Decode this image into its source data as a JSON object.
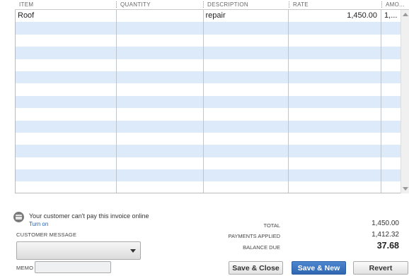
{
  "grid": {
    "columns": [
      "ITEM",
      "QUANTITY",
      "DESCRIPTION",
      "RATE",
      "AMO..."
    ],
    "rows": [
      {
        "item": "Roof",
        "quantity": "",
        "description": "repair",
        "rate": "1,450.00",
        "amount": "1,..."
      }
    ],
    "empty_row_count": 14
  },
  "payment": {
    "notice": "Your customer can't pay this invoice online",
    "turn_on": "Turn on"
  },
  "form": {
    "customer_message_label": "CUSTOMER MESSAGE",
    "customer_message_value": "",
    "memo_label": "MEMO",
    "memo_value": ""
  },
  "totals": {
    "total_label": "TOTAL",
    "total_value": "1,450.00",
    "payments_label": "PAYMENTS APPLIED",
    "payments_value": "1,412.32",
    "balance_label": "BALANCE DUE",
    "balance_value": "37.68"
  },
  "buttons": {
    "save_close": "Save & Close",
    "save_new": "Save & New",
    "revert": "Revert"
  },
  "colors": {
    "row_stripe": "#ddeafa",
    "primary_button": "#2f66b1",
    "link": "#2460b0"
  }
}
